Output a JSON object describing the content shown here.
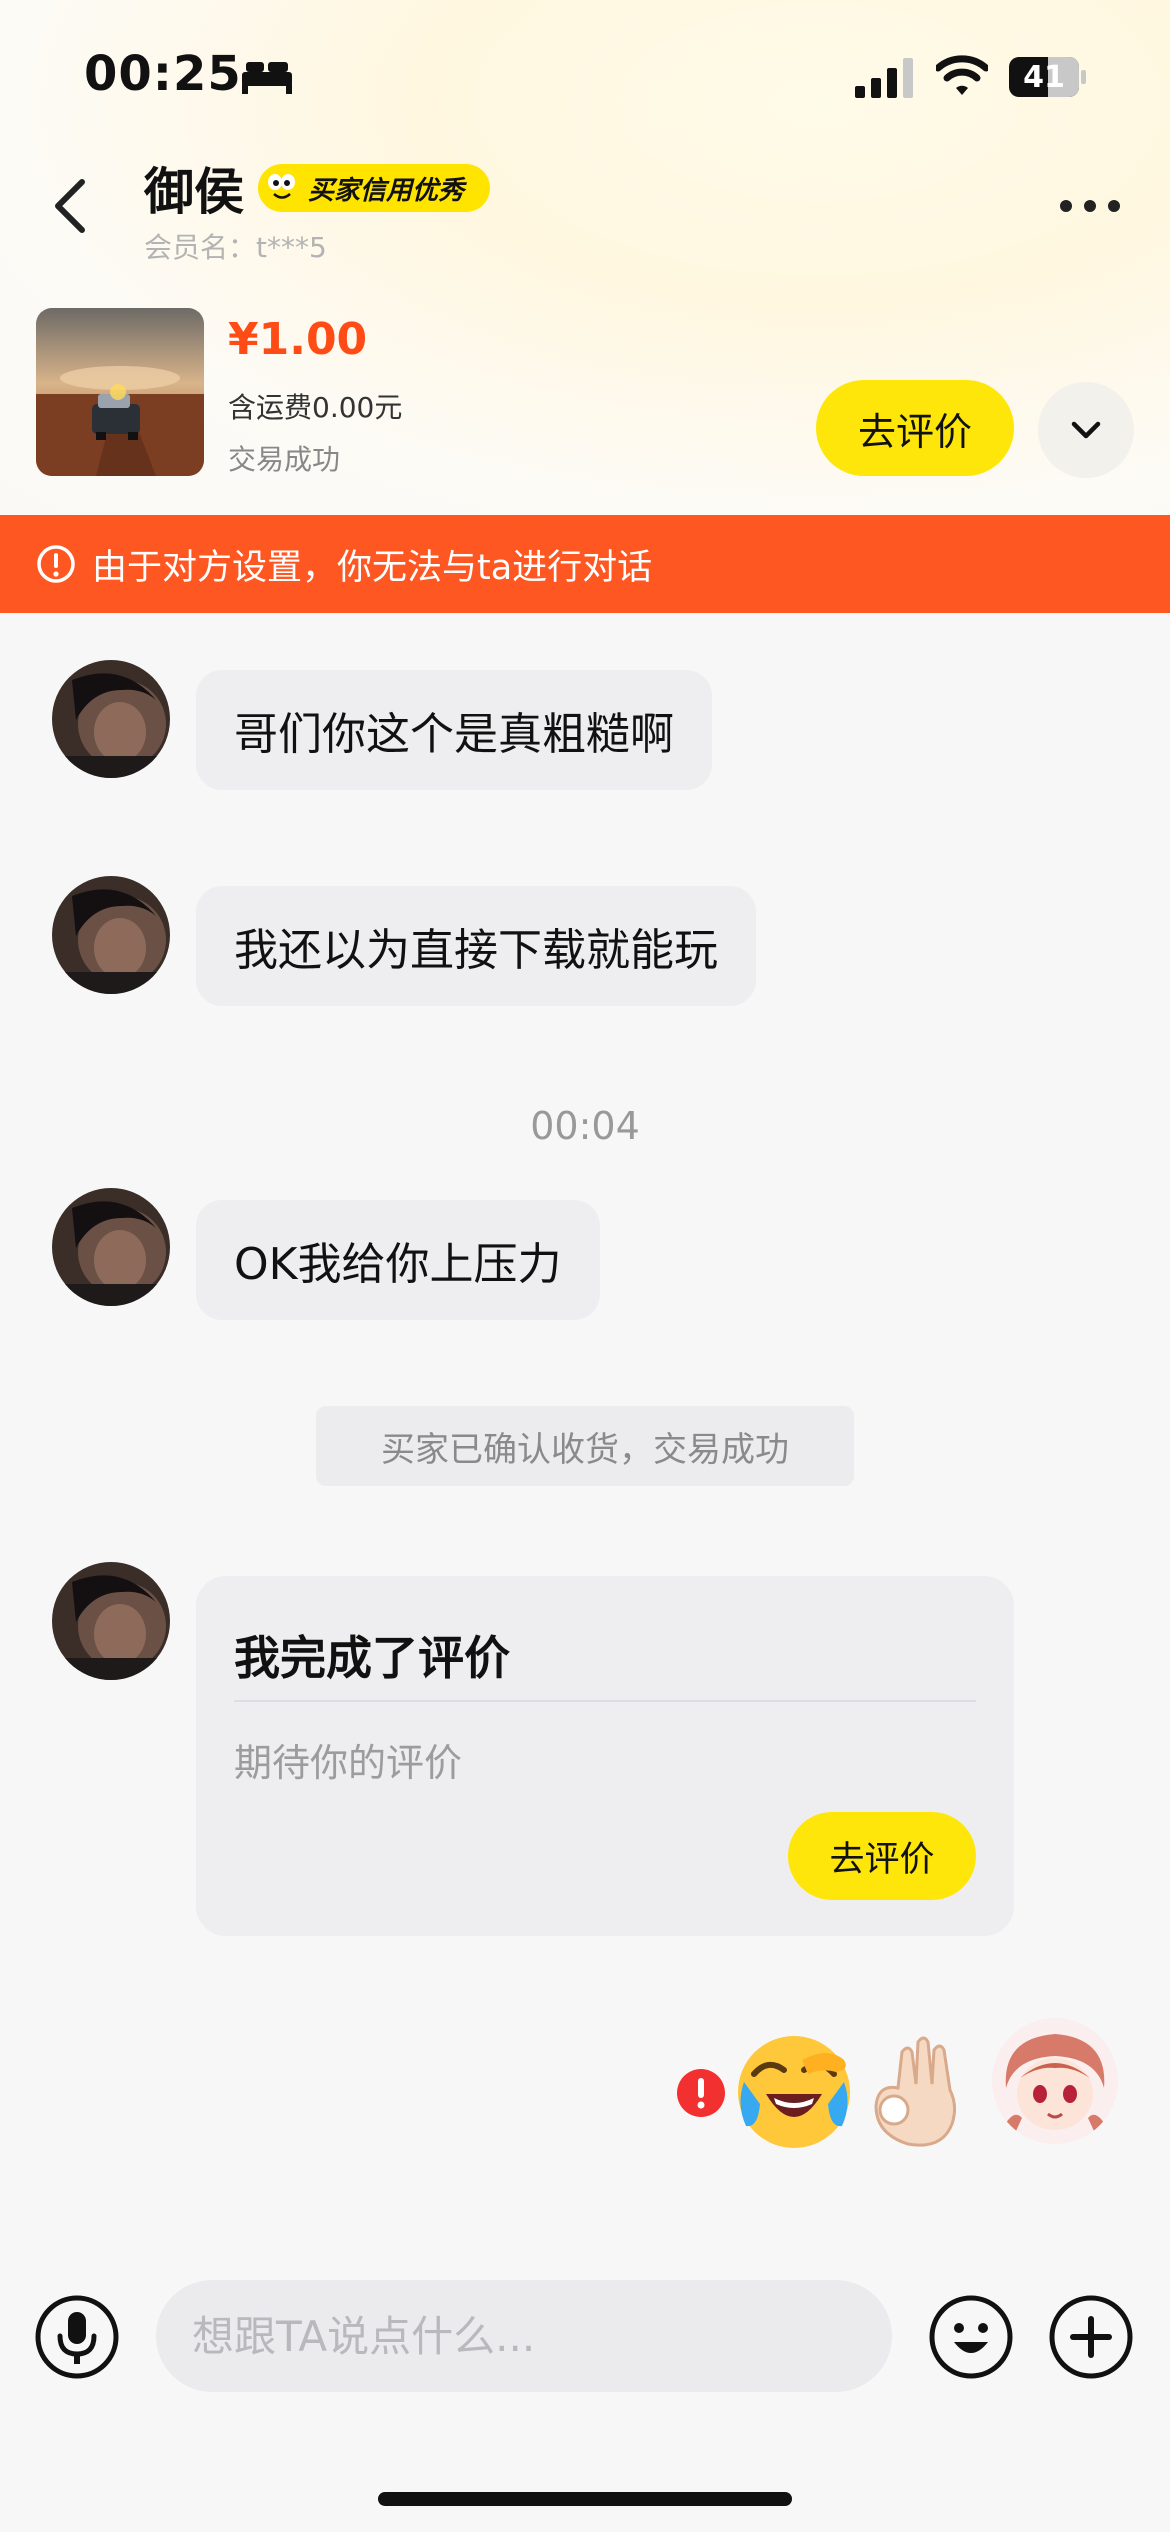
{
  "status_bar": {
    "time": "00:25",
    "battery": "41",
    "icons": [
      "bed-icon",
      "signal-icon",
      "wifi-icon",
      "battery-icon"
    ]
  },
  "header": {
    "name": "御侯",
    "credit_badge": "买家信用优秀",
    "member_name": "会员名：t***5"
  },
  "product": {
    "price": "¥1.00",
    "shipping": "含运费0.00元",
    "status": "交易成功",
    "review_button": "去评价"
  },
  "warning": {
    "text": "由于对方设置，你无法与ta进行对话"
  },
  "messages": [
    {
      "text": "哥们你这个是真粗糙啊"
    },
    {
      "text": "我还以为直接下载就能玩"
    },
    {
      "text": "OK我给你上压力"
    }
  ],
  "timestamp": "00:04",
  "system_message": "买家已确认收货，交易成功",
  "review_card": {
    "title": "我完成了评价",
    "subtitle": "期待你的评价",
    "button": "去评价"
  },
  "outgoing": {
    "emojis": [
      "crying-laughing-emoji",
      "ok-hand-emoji"
    ],
    "send_failed": true
  },
  "input_bar": {
    "placeholder": "想跟TA说点什么..."
  },
  "colors": {
    "accent_yellow": "#ffe60a",
    "warning_orange": "#ff5722",
    "price_red": "#ff4c16"
  }
}
